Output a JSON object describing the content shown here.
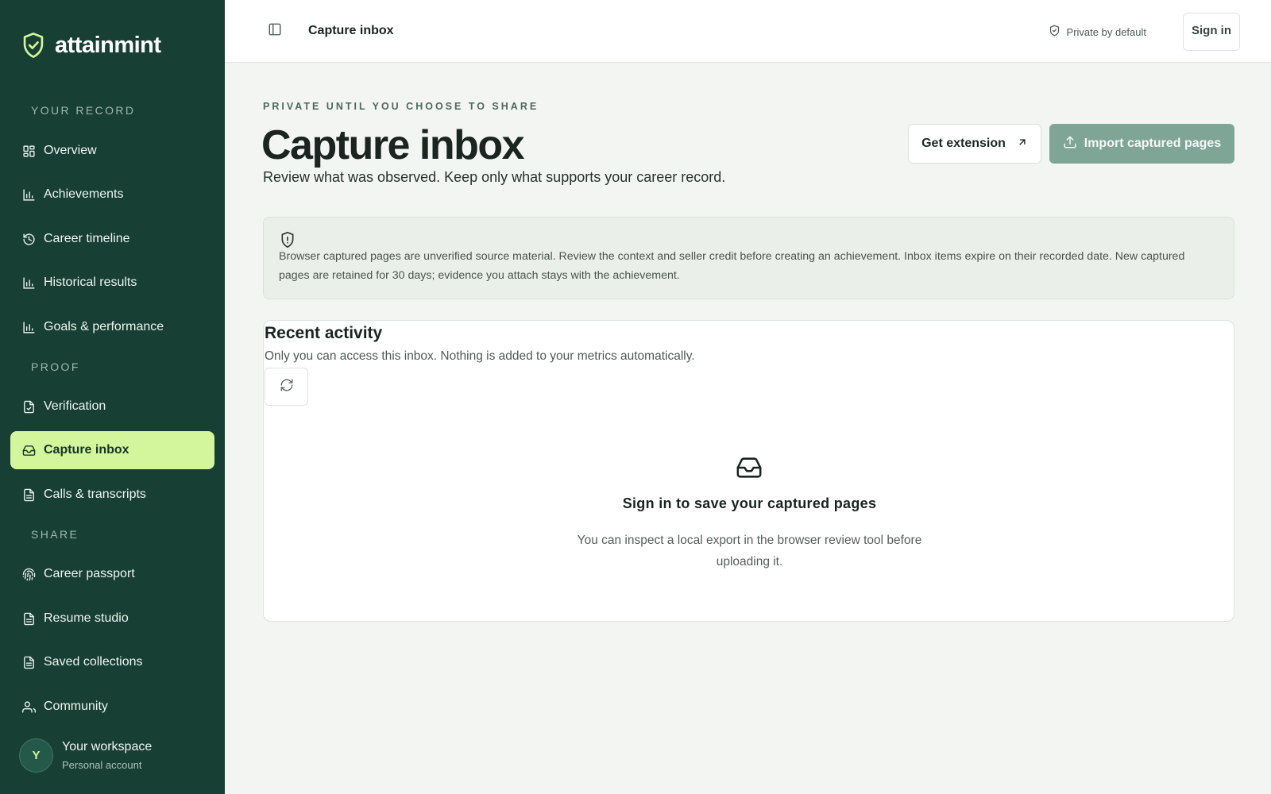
{
  "brand": {
    "name": "attainmint",
    "icon": "shield-check-icon"
  },
  "sidebar": {
    "sections": [
      {
        "label": "YOUR RECORD"
      },
      {
        "label": "PROOF"
      },
      {
        "label": "SHARE"
      }
    ],
    "items": [
      {
        "label": "Overview",
        "icon": "grid-icon"
      },
      {
        "label": "Achievements",
        "icon": "bar-chart-icon"
      },
      {
        "label": "Career timeline",
        "icon": "history-icon"
      },
      {
        "label": "Historical results",
        "icon": "bar-chart-icon"
      },
      {
        "label": "Goals & performance",
        "icon": "bar-chart-icon"
      },
      {
        "label": "Verification",
        "icon": "file-check-icon"
      },
      {
        "label": "Capture inbox",
        "icon": "inbox-icon",
        "active": true
      },
      {
        "label": "Calls & transcripts",
        "icon": "file-text-icon"
      },
      {
        "label": "Career passport",
        "icon": "fingerprint-icon"
      },
      {
        "label": "Resume studio",
        "icon": "file-text-icon"
      },
      {
        "label": "Saved collections",
        "icon": "file-text-icon"
      },
      {
        "label": "Community",
        "icon": "users-icon"
      }
    ],
    "workspace": {
      "avatar": "Y",
      "title": "Your workspace",
      "subtitle": "Personal account"
    }
  },
  "header": {
    "title": "Capture inbox",
    "privacy_label": "Private by default",
    "sign_in_label": "Sign in"
  },
  "main": {
    "eyebrow": "PRIVATE UNTIL YOU CHOOSE TO SHARE",
    "title": "Capture inbox",
    "subtitle": "Review what was observed. Keep only what supports your career record.",
    "get_extension_label": "Get extension",
    "import_label": "Import captured pages",
    "notice": "Browser captured pages are unverified source material. Review the context and seller credit before creating an achievement. Inbox items expire on their recorded date. New captured pages are retained for 30 days; evidence you attach stays with the achievement.",
    "activity": {
      "title": "Recent activity",
      "subtitle": "Only you can access this inbox. Nothing is added to your metrics automatically.",
      "empty_title": "Sign in to save your captured pages",
      "empty_desc": "You can inspect a local export in the browser review tool before uploading it."
    }
  },
  "colors": {
    "sidebar_bg": "#173f33",
    "active_item_bg": "#d3f59b",
    "import_button_bg": "#7fa597",
    "notice_bg": "#eaf0e9"
  }
}
